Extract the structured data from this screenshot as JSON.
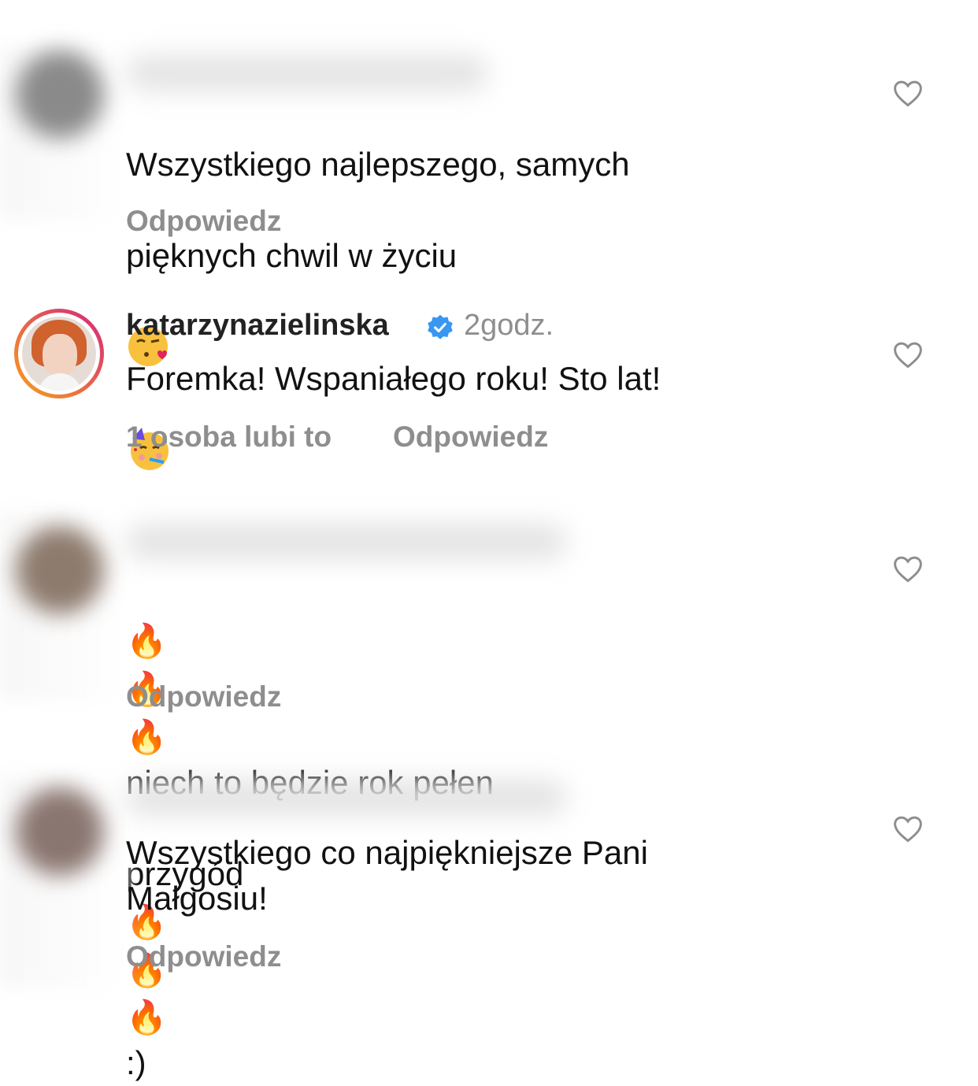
{
  "comments": [
    {
      "text_line1": "Wszystkiego najlepszego,  samych",
      "text_line2": "pięknych chwil w życiu",
      "emoji_icons": [
        "kissing-heart-emoji",
        "partying-face-emoji"
      ],
      "reply_label": "Odpowiedz"
    },
    {
      "username": "katarzynazielinska",
      "verified": true,
      "time": "2godz.",
      "text": "Foremka! Wspaniałego roku! Sto lat!",
      "likes_label": "1 osoba lubi to",
      "reply_label": "Odpowiedz"
    },
    {
      "text_line1": "niech to będzie rok pełen",
      "text_line2_prefix": "przygód",
      "text_line2_suffix": ":)",
      "emoji_icons": [
        "fire-emoji"
      ],
      "reply_label": "Odpowiedz"
    },
    {
      "text": "Wszystkiego co najpiękniejsze Pani\nMałgosiu!",
      "reply_label": "Odpowiedz"
    }
  ],
  "colors": {
    "secondary_text": "#8e8e8e",
    "verified_blue": "#3897f0",
    "story_ring_start": "#f9a11b",
    "story_ring_end": "#d3267d"
  }
}
